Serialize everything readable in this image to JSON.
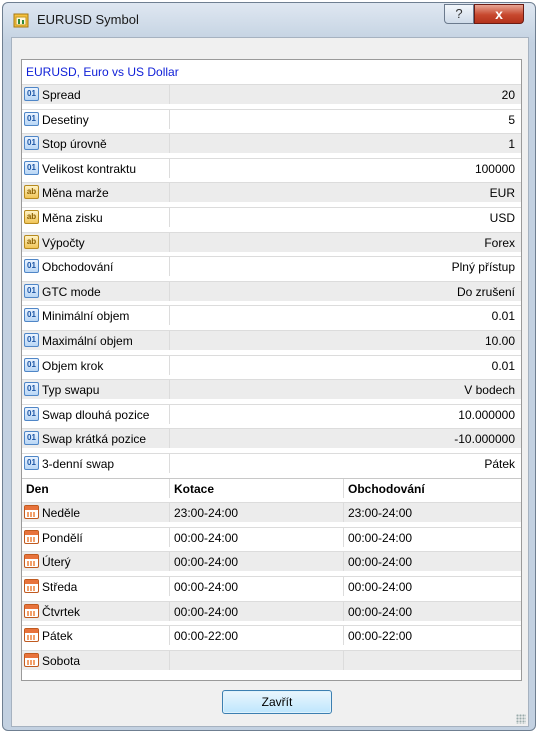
{
  "window": {
    "title": "EURUSD Symbol",
    "help_label": "?",
    "close_label": "x"
  },
  "symbol_header": "EURUSD, Euro vs US Dollar",
  "properties": [
    {
      "icon": "numeric-field-icon",
      "name": "Spread",
      "value": "20"
    },
    {
      "icon": "numeric-field-icon",
      "name": "Desetiny",
      "value": "5"
    },
    {
      "icon": "numeric-field-icon",
      "name": "Stop úrovně",
      "value": "1"
    },
    {
      "icon": "numeric-field-icon",
      "name": "Velikost kontraktu",
      "value": "100000"
    },
    {
      "icon": "text-field-icon",
      "name": "Měna marže",
      "value": "EUR"
    },
    {
      "icon": "text-field-icon",
      "name": "Měna zisku",
      "value": "USD"
    },
    {
      "icon": "text-field-icon",
      "name": "Výpočty",
      "value": "Forex"
    },
    {
      "icon": "numeric-field-icon",
      "name": "Obchodování",
      "value": "Plný přístup"
    },
    {
      "icon": "numeric-field-icon",
      "name": "GTC mode",
      "value": "Do zrušení"
    },
    {
      "icon": "numeric-field-icon",
      "name": "Minimální objem",
      "value": "0.01"
    },
    {
      "icon": "numeric-field-icon",
      "name": "Maximální objem",
      "value": "10.00"
    },
    {
      "icon": "numeric-field-icon",
      "name": "Objem krok",
      "value": "0.01"
    },
    {
      "icon": "numeric-field-icon",
      "name": "Typ swapu",
      "value": "V bodech"
    },
    {
      "icon": "numeric-field-icon",
      "name": "Swap dlouhá pozice",
      "value": "10.000000"
    },
    {
      "icon": "numeric-field-icon",
      "name": "Swap krátká pozice",
      "value": "-10.000000"
    },
    {
      "icon": "numeric-field-icon",
      "name": "3-denní swap",
      "value": "Pátek"
    }
  ],
  "schedule": {
    "headers": [
      "Den",
      "Kotace",
      "Obchodování"
    ],
    "rows": [
      {
        "day": "Neděle",
        "quotes": "23:00-24:00",
        "trading": "23:00-24:00"
      },
      {
        "day": "Pondělí",
        "quotes": "00:00-24:00",
        "trading": "00:00-24:00"
      },
      {
        "day": "Úterý",
        "quotes": "00:00-24:00",
        "trading": "00:00-24:00"
      },
      {
        "day": "Středa",
        "quotes": "00:00-24:00",
        "trading": "00:00-24:00"
      },
      {
        "day": "Čtvrtek",
        "quotes": "00:00-24:00",
        "trading": "00:00-24:00"
      },
      {
        "day": "Pátek",
        "quotes": "00:00-22:00",
        "trading": "00:00-22:00"
      },
      {
        "day": "Sobota",
        "quotes": "",
        "trading": ""
      }
    ]
  },
  "close_button_label": "Zavřít",
  "icon_glyphs": {
    "numeric": "01",
    "text": "ab"
  },
  "colors": {
    "header_text": "#1020d8",
    "close_button_red": "#c7482e"
  }
}
